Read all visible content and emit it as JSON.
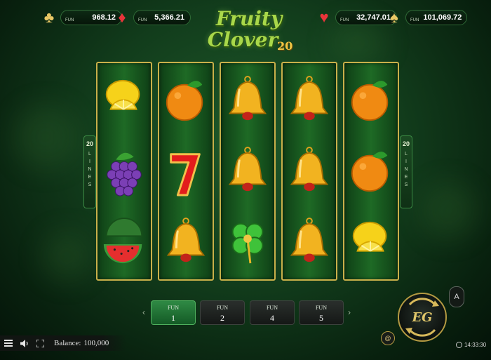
{
  "jackpots": [
    {
      "suit": "clubs",
      "symbol": "♣",
      "label": "FUN",
      "value": "968.12",
      "color": "#e8c765"
    },
    {
      "suit": "diamonds",
      "symbol": "♦",
      "label": "FUN",
      "value": "5,366.21",
      "color": "#e8343a"
    },
    {
      "suit": "hearts",
      "symbol": "♥",
      "label": "FUN",
      "value": "32,747.01",
      "color": "#e8343a"
    },
    {
      "suit": "spades",
      "symbol": "♠",
      "label": "FUN",
      "value": "101,069.72",
      "color": "#e8c765"
    }
  ],
  "logo": {
    "line1": "Fruity",
    "line2": "Clover",
    "number": "20"
  },
  "lines_indicator": {
    "count": "20",
    "word": [
      "L",
      "I",
      "N",
      "E",
      "S"
    ]
  },
  "reels": [
    [
      "lemon",
      "grapes",
      "watermelon"
    ],
    [
      "orange",
      "seven",
      "bell"
    ],
    [
      "bell",
      "bell",
      "clover"
    ],
    [
      "bell",
      "bell",
      "bell"
    ],
    [
      "orange",
      "orange",
      "lemon"
    ]
  ],
  "bets": [
    {
      "label": "FUN",
      "value": "1",
      "active": true
    },
    {
      "label": "FUN",
      "value": "2",
      "active": false
    },
    {
      "label": "FUN",
      "value": "4",
      "active": false
    },
    {
      "label": "FUN",
      "value": "5",
      "active": false
    }
  ],
  "controls": {
    "prev_icon": "chevron-left-icon",
    "next_icon": "chevron-right-icon",
    "spin_logo": "EG",
    "auto_label": "A",
    "turbo_icon": "snail-icon"
  },
  "bottom_bar": {
    "menu_icon": "hamburger-icon",
    "sound_icon": "speaker-icon",
    "fullscreen_icon": "fullscreen-icon",
    "balance_label": "Balance:",
    "balance_value": "100,000"
  },
  "clock": "14:33:30",
  "colors": {
    "reel_border": "#c9b04a",
    "active_bet": "#2f8a44",
    "background": "#123d1c"
  }
}
